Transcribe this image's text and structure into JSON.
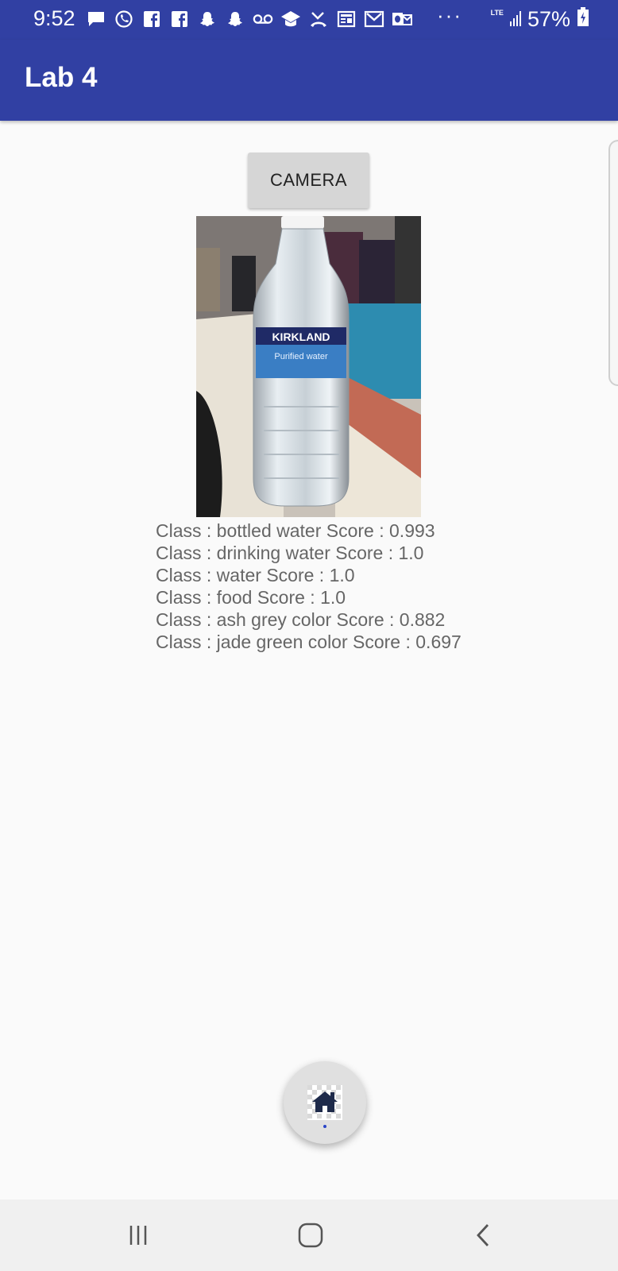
{
  "status_bar": {
    "time": "9:52",
    "notification_icons": [
      "message-icon",
      "whatsapp-icon",
      "facebook-icon",
      "facebook-icon",
      "snapchat-icon",
      "snapchat-icon",
      "voicemail-icon",
      "education-icon",
      "missed-call-icon",
      "news-icon",
      "gmail-icon",
      "outlook-icon"
    ],
    "more_indicator": "···",
    "network": "LTE",
    "battery_percent": "57%",
    "colors": {
      "background": "#3140a3"
    }
  },
  "app_bar": {
    "title": "Lab 4",
    "background": "#3140a3"
  },
  "camera_button": {
    "label": "CAMERA"
  },
  "results": [
    "Class : bottled water Score : 0.993",
    "Class : drinking water Score : 1.0",
    "Class : water Score : 1.0",
    "Class : food Score : 1.0",
    "Class : ash grey color Score : 0.882",
    "Class : jade green color Score : 0.697"
  ],
  "photo": {
    "label_text": "KIRKLAND",
    "label_subtext": "Purified water"
  },
  "fab": {
    "icon": "home-icon"
  },
  "nav_bar": {
    "icons": [
      "recent-apps-icon",
      "home-icon",
      "back-icon"
    ]
  }
}
